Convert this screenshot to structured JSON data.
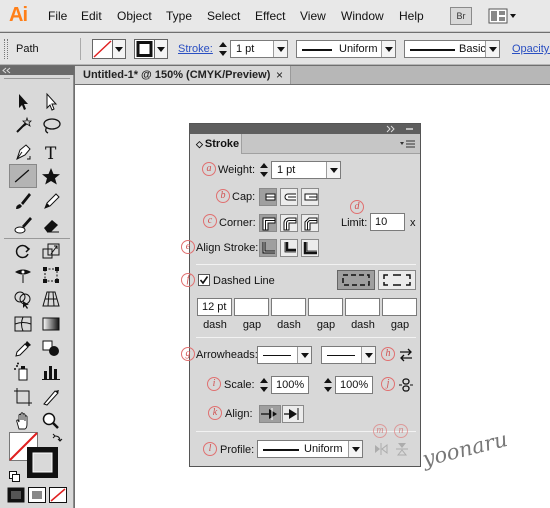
{
  "app": {
    "logo": "Ai"
  },
  "menu": [
    "File",
    "Edit",
    "Object",
    "Type",
    "Select",
    "Effect",
    "View",
    "Window",
    "Help"
  ],
  "menu_right": {
    "bridge_label": "Br"
  },
  "control_bar": {
    "path_label": "Path",
    "stroke_label": "Stroke:",
    "stroke_weight": "1 pt",
    "variable_width": "Uniform",
    "brush": "Basic",
    "opacity_label": "Opacity:"
  },
  "document": {
    "tab_title": "Untitled-1* @ 150% (CMYK/Preview)"
  },
  "stroke_panel": {
    "title": "Stroke",
    "markers": [
      "a",
      "b",
      "c",
      "d",
      "e",
      "f",
      "g",
      "h",
      "i",
      "j",
      "k",
      "l",
      "m",
      "n"
    ],
    "weight_label": "Weight:",
    "weight_value": "1 pt",
    "cap_label": "Cap:",
    "corner_label": "Corner:",
    "limit_label": "Limit:",
    "limit_value": "10",
    "limit_unit": "x",
    "align_stroke_label": "Align Stroke:",
    "dashed_line_label": "Dashed Line",
    "dashed_checked": true,
    "dash_fields": [
      {
        "value": "12 pt",
        "label": "dash"
      },
      {
        "value": "",
        "label": "gap"
      },
      {
        "value": "",
        "label": "dash"
      },
      {
        "value": "",
        "label": "gap"
      },
      {
        "value": "",
        "label": "dash"
      },
      {
        "value": "",
        "label": "gap"
      }
    ],
    "arrowheads_label": "Arrowheads:",
    "scale_label": "Scale:",
    "scale_start": "100%",
    "scale_end": "100%",
    "align_label": "Align:",
    "profile_label": "Profile:",
    "profile_value": "Uniform"
  },
  "watermark": "yoonaru"
}
